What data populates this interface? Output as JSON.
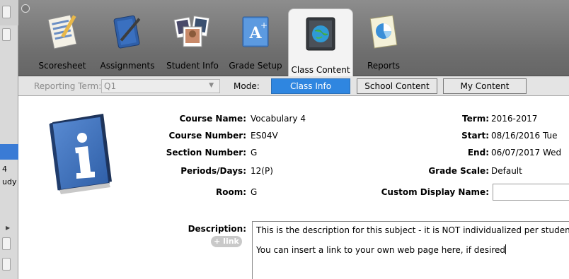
{
  "toolbar": {
    "tabs": [
      {
        "label": "Scoresheet",
        "icon": "scoresheet-icon"
      },
      {
        "label": "Assignments",
        "icon": "assignments-icon"
      },
      {
        "label": "Student Info",
        "icon": "student-photos-icon"
      },
      {
        "label": "Grade Setup",
        "icon": "grade-setup-icon"
      },
      {
        "label": "Class Content",
        "icon": "globe-book-icon",
        "active": true
      },
      {
        "label": "Reports",
        "icon": "pie-chart-report-icon"
      }
    ]
  },
  "left_strip": {
    "line1": "4",
    "line2": "udy"
  },
  "modebar": {
    "term_label": "Reporting Term:",
    "term_value": "Q1",
    "mode_label": "Mode:",
    "modes": [
      "Class Info",
      "School Content",
      "My Content"
    ],
    "active_mode": "Class Info"
  },
  "course": {
    "name_label": "Course Name:",
    "name": "Vocabulary 4",
    "number_label": "Course Number:",
    "number": "ES04V",
    "section_label": "Section Number:",
    "section": "G",
    "periods_label": "Periods/Days:",
    "periods": "12(P)",
    "room_label": "Room:",
    "room": "G",
    "term_label": "Term:",
    "term": "2016-2017",
    "start_label": "Start:",
    "start": "08/16/2016 Tue",
    "end_label": "End:",
    "end": "06/07/2017 Wed",
    "grade_scale_label": "Grade Scale:",
    "grade_scale": "Default",
    "custom_display_label": "Custom Display Name:",
    "custom_display_value": "",
    "description_label": "Description:",
    "link_label": "+ link",
    "description_line1": "This is the description for this subject - it is NOT individualized per student",
    "description_line2": "You can insert a link to your own web page here, if desired"
  },
  "colors": {
    "toolbar": "#7a7a7a",
    "active_mode": "#2f86e0",
    "book": "#3b6fb6"
  }
}
